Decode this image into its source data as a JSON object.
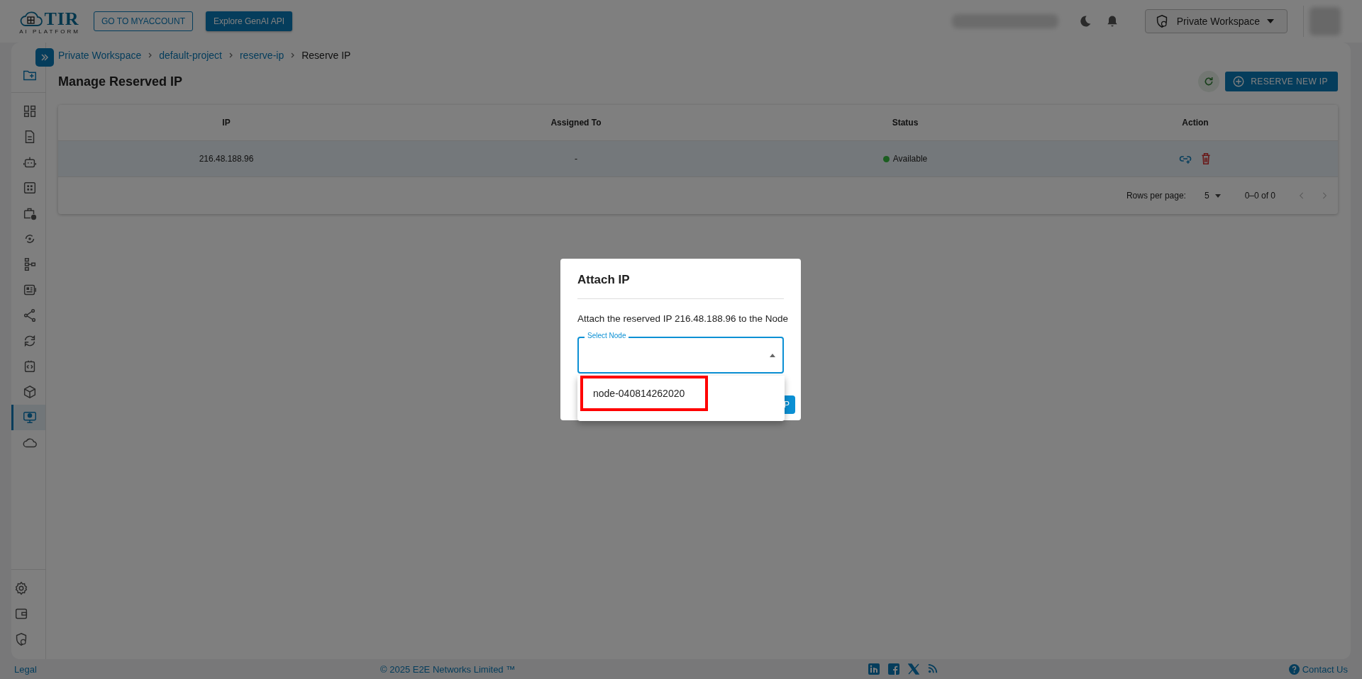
{
  "header": {
    "logo": {
      "name": "TIR",
      "tagline": "AI PLATFORM"
    },
    "account_button": "GO TO MYACCOUNT",
    "genai_button": "Explore GenAI API",
    "workspace_select": "Private Workspace"
  },
  "sidebar": {
    "items": [
      {
        "selected": false
      },
      {
        "selected": false
      },
      {
        "selected": false
      },
      {
        "selected": false
      },
      {
        "selected": false
      },
      {
        "selected": false
      },
      {
        "selected": false
      },
      {
        "selected": false
      },
      {
        "selected": false
      },
      {
        "selected": false
      },
      {
        "selected": false
      },
      {
        "selected": false
      },
      {
        "selected": true
      },
      {
        "selected": false
      }
    ],
    "bottom_items": [
      {
        "selected": false
      },
      {
        "selected": false
      },
      {
        "selected": false
      }
    ]
  },
  "breadcrumb": [
    {
      "label": "Private Workspace",
      "link": true
    },
    {
      "label": "default-project",
      "link": true
    },
    {
      "label": "reserve-ip",
      "link": true
    },
    {
      "label": "Reserve IP",
      "link": false
    }
  ],
  "page_title": "Manage Reserved IP",
  "reserve_button": "RESERVE NEW IP",
  "table": {
    "columns": [
      "IP",
      "Assigned To",
      "Status",
      "Action"
    ],
    "rows": [
      {
        "ip": "216.48.188.96",
        "assigned_to": "-",
        "status": "Available",
        "color": "#1b5e20"
      }
    ],
    "pagination": {
      "rows_per_page_label": "Rows per page:",
      "rows_per_page": "5",
      "range": "0–0 of 0"
    }
  },
  "dialog": {
    "title": "Attach IP",
    "message": "Attach the reserved IP 216.48.188.96 to the Node",
    "select": {
      "label": "Select Node",
      "expanded": true,
      "options": [
        {
          "label": "node-040814262020",
          "highlighted": true
        }
      ]
    },
    "partial_button": "P"
  },
  "footer": {
    "legal": "Legal",
    "copyright": "© 2025 E2E Networks Limited ™",
    "contact": "Contact Us"
  }
}
